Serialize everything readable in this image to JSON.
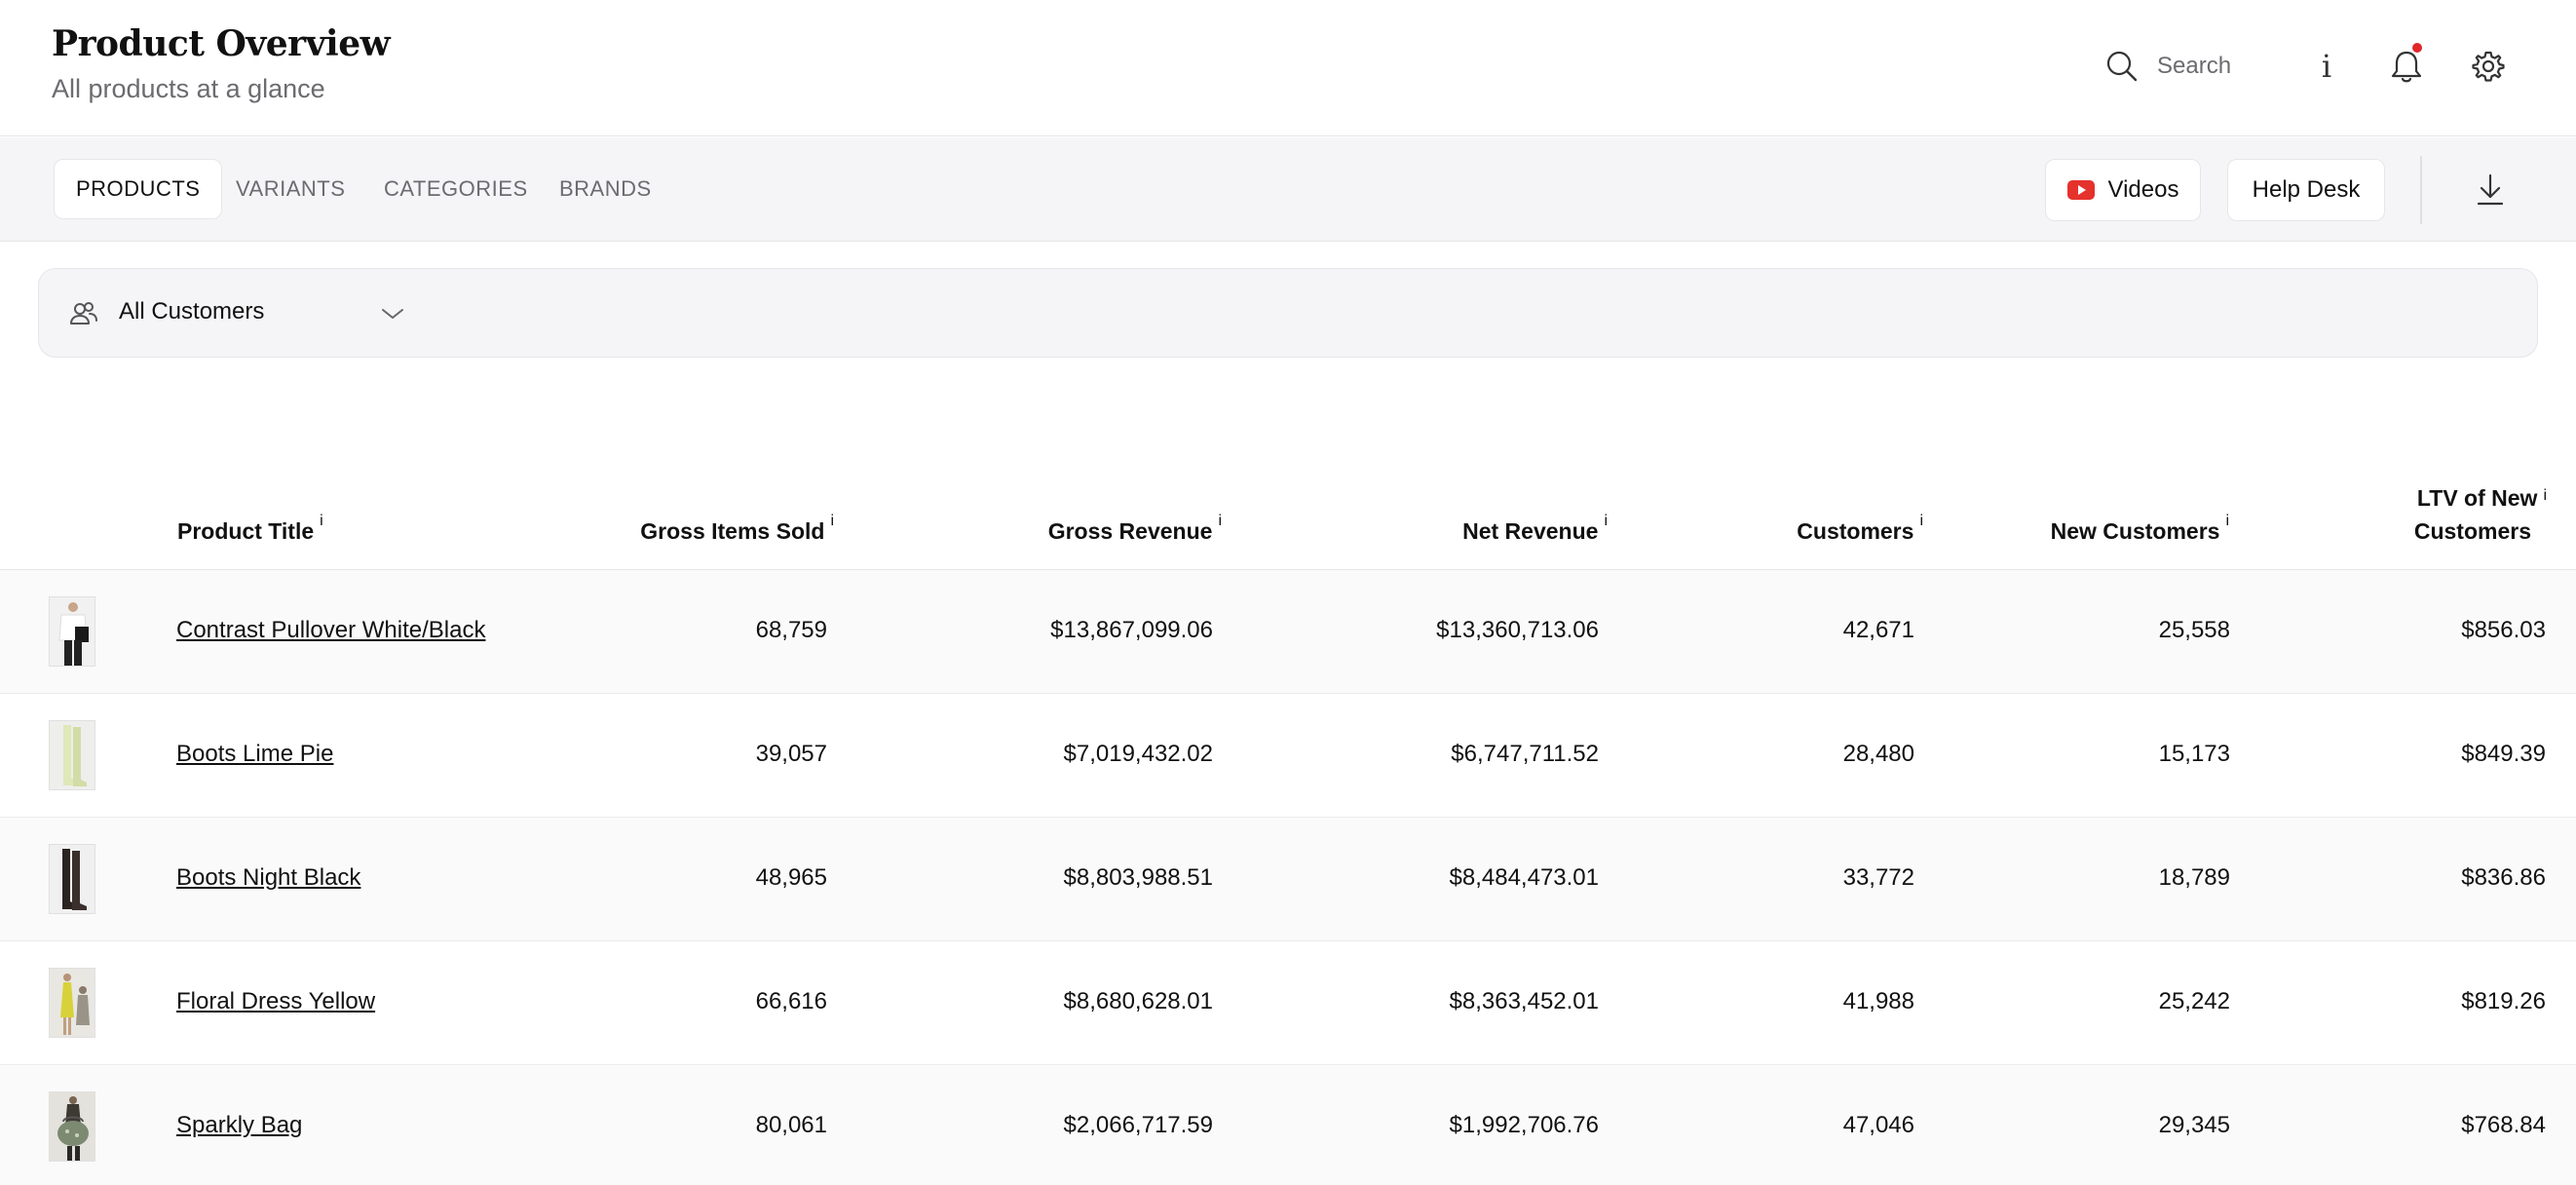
{
  "header": {
    "title": "Product Overview",
    "subtitle": "All products at a glance",
    "search_placeholder": "Search",
    "icons": [
      "search-icon",
      "info-icon",
      "bell-icon",
      "gear-icon"
    ],
    "info_glyph": "i"
  },
  "tabs": [
    {
      "label": "PRODUCTS",
      "active": true
    },
    {
      "label": "VARIANTS",
      "active": false
    },
    {
      "label": "CATEGORIES",
      "active": false
    },
    {
      "label": "BRANDS",
      "active": false
    }
  ],
  "toolbar": {
    "videos_label": "Videos",
    "helpdesk_label": "Help Desk"
  },
  "filter": {
    "selected": "All Customers"
  },
  "colors": {
    "accent_red": "#e0262b",
    "youtube_red": "#e5322d"
  },
  "table": {
    "info_marker": "i",
    "columns": {
      "product_title": "Product Title",
      "gross_items_sold": "Gross Items Sold",
      "gross_revenue": "Gross Revenue",
      "net_revenue": "Net Revenue",
      "customers": "Customers",
      "new_customers": "New Customers",
      "ltv_line1": "LTV of New",
      "ltv_line2": "Customers"
    },
    "rows": [
      {
        "title": "Contrast Pullover White/Black",
        "gross_items_sold": "68,759",
        "gross_revenue": "$13,867,099.06",
        "net_revenue": "$13,360,713.06",
        "customers": "42,671",
        "new_customers": "25,558",
        "ltv": "$856.03"
      },
      {
        "title": "Boots Lime Pie",
        "gross_items_sold": "39,057",
        "gross_revenue": "$7,019,432.02",
        "net_revenue": "$6,747,711.52",
        "customers": "28,480",
        "new_customers": "15,173",
        "ltv": "$849.39"
      },
      {
        "title": "Boots Night Black",
        "gross_items_sold": "48,965",
        "gross_revenue": "$8,803,988.51",
        "net_revenue": "$8,484,473.01",
        "customers": "33,772",
        "new_customers": "18,789",
        "ltv": "$836.86"
      },
      {
        "title": "Floral Dress Yellow",
        "gross_items_sold": "66,616",
        "gross_revenue": "$8,680,628.01",
        "net_revenue": "$8,363,452.01",
        "customers": "41,988",
        "new_customers": "25,242",
        "ltv": "$819.26"
      },
      {
        "title": "Sparkly Bag",
        "gross_items_sold": "80,061",
        "gross_revenue": "$2,066,717.59",
        "net_revenue": "$1,992,706.76",
        "customers": "47,046",
        "new_customers": "29,345",
        "ltv": "$768.84"
      }
    ]
  }
}
